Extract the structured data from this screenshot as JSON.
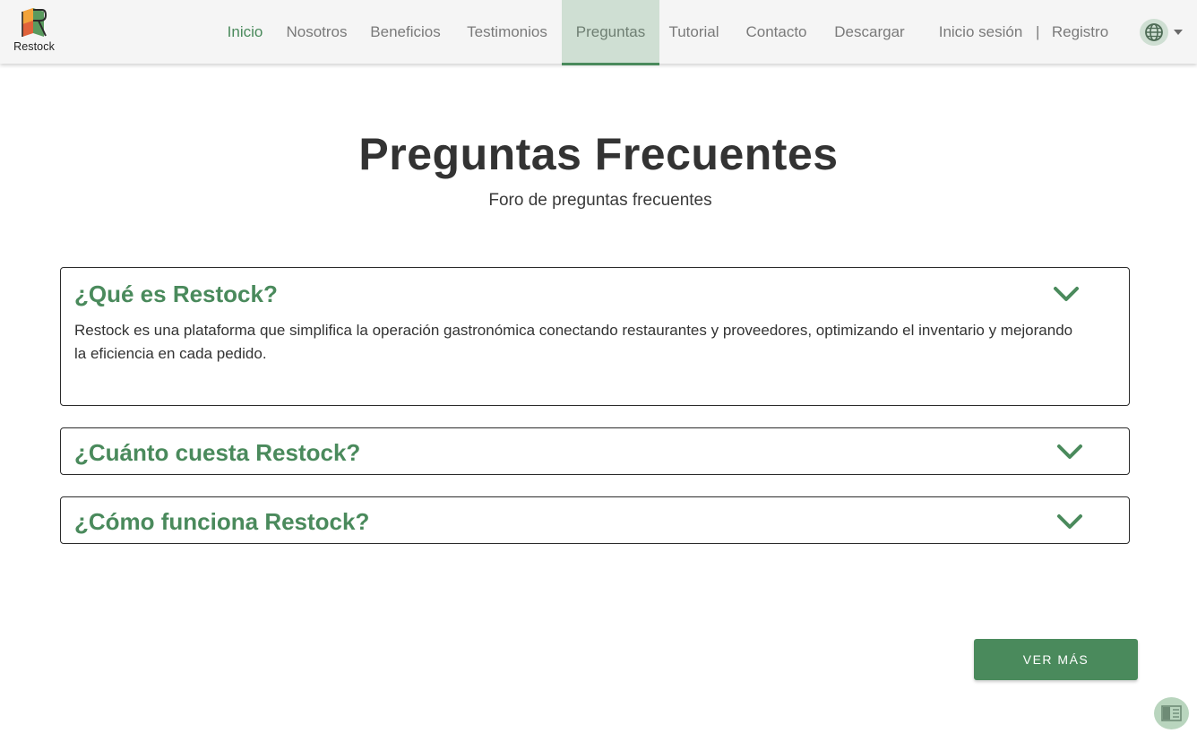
{
  "header": {
    "logo_text": "Restock",
    "nav": [
      {
        "label": "Inicio"
      },
      {
        "label": "Nosotros"
      },
      {
        "label": "Beneficios"
      },
      {
        "label": "Testimonios"
      },
      {
        "label": "Preguntas"
      },
      {
        "label": "Tutorial"
      },
      {
        "label": "Contacto"
      },
      {
        "label": "Descargar"
      }
    ],
    "login": "Inicio sesión",
    "separator": "|",
    "register": "Registro",
    "language_icon": "globe-icon"
  },
  "main": {
    "title": "Preguntas Frecuentes",
    "subtitle": "Foro de preguntas frecuentes",
    "faqs": [
      {
        "question": "¿Qué es Restock?",
        "answer": "Restock es una plataforma que simplifica la operación gastronómica conectando restaurantes y proveedores, optimizando el inventario y mejorando la eficiencia en cada pedido.",
        "expanded": true
      },
      {
        "question": "¿Cuánto cuesta Restock?",
        "expanded": false
      },
      {
        "question": "¿Cómo funciona Restock?",
        "expanded": false
      }
    ],
    "more_button": "VER MÁS",
    "reader_icon": "reader-mode-icon"
  },
  "colors": {
    "accent": "#4a8a5c",
    "accent_light": "#cfdfd3",
    "header_bg": "#f5f5f5",
    "text": "#333333"
  }
}
